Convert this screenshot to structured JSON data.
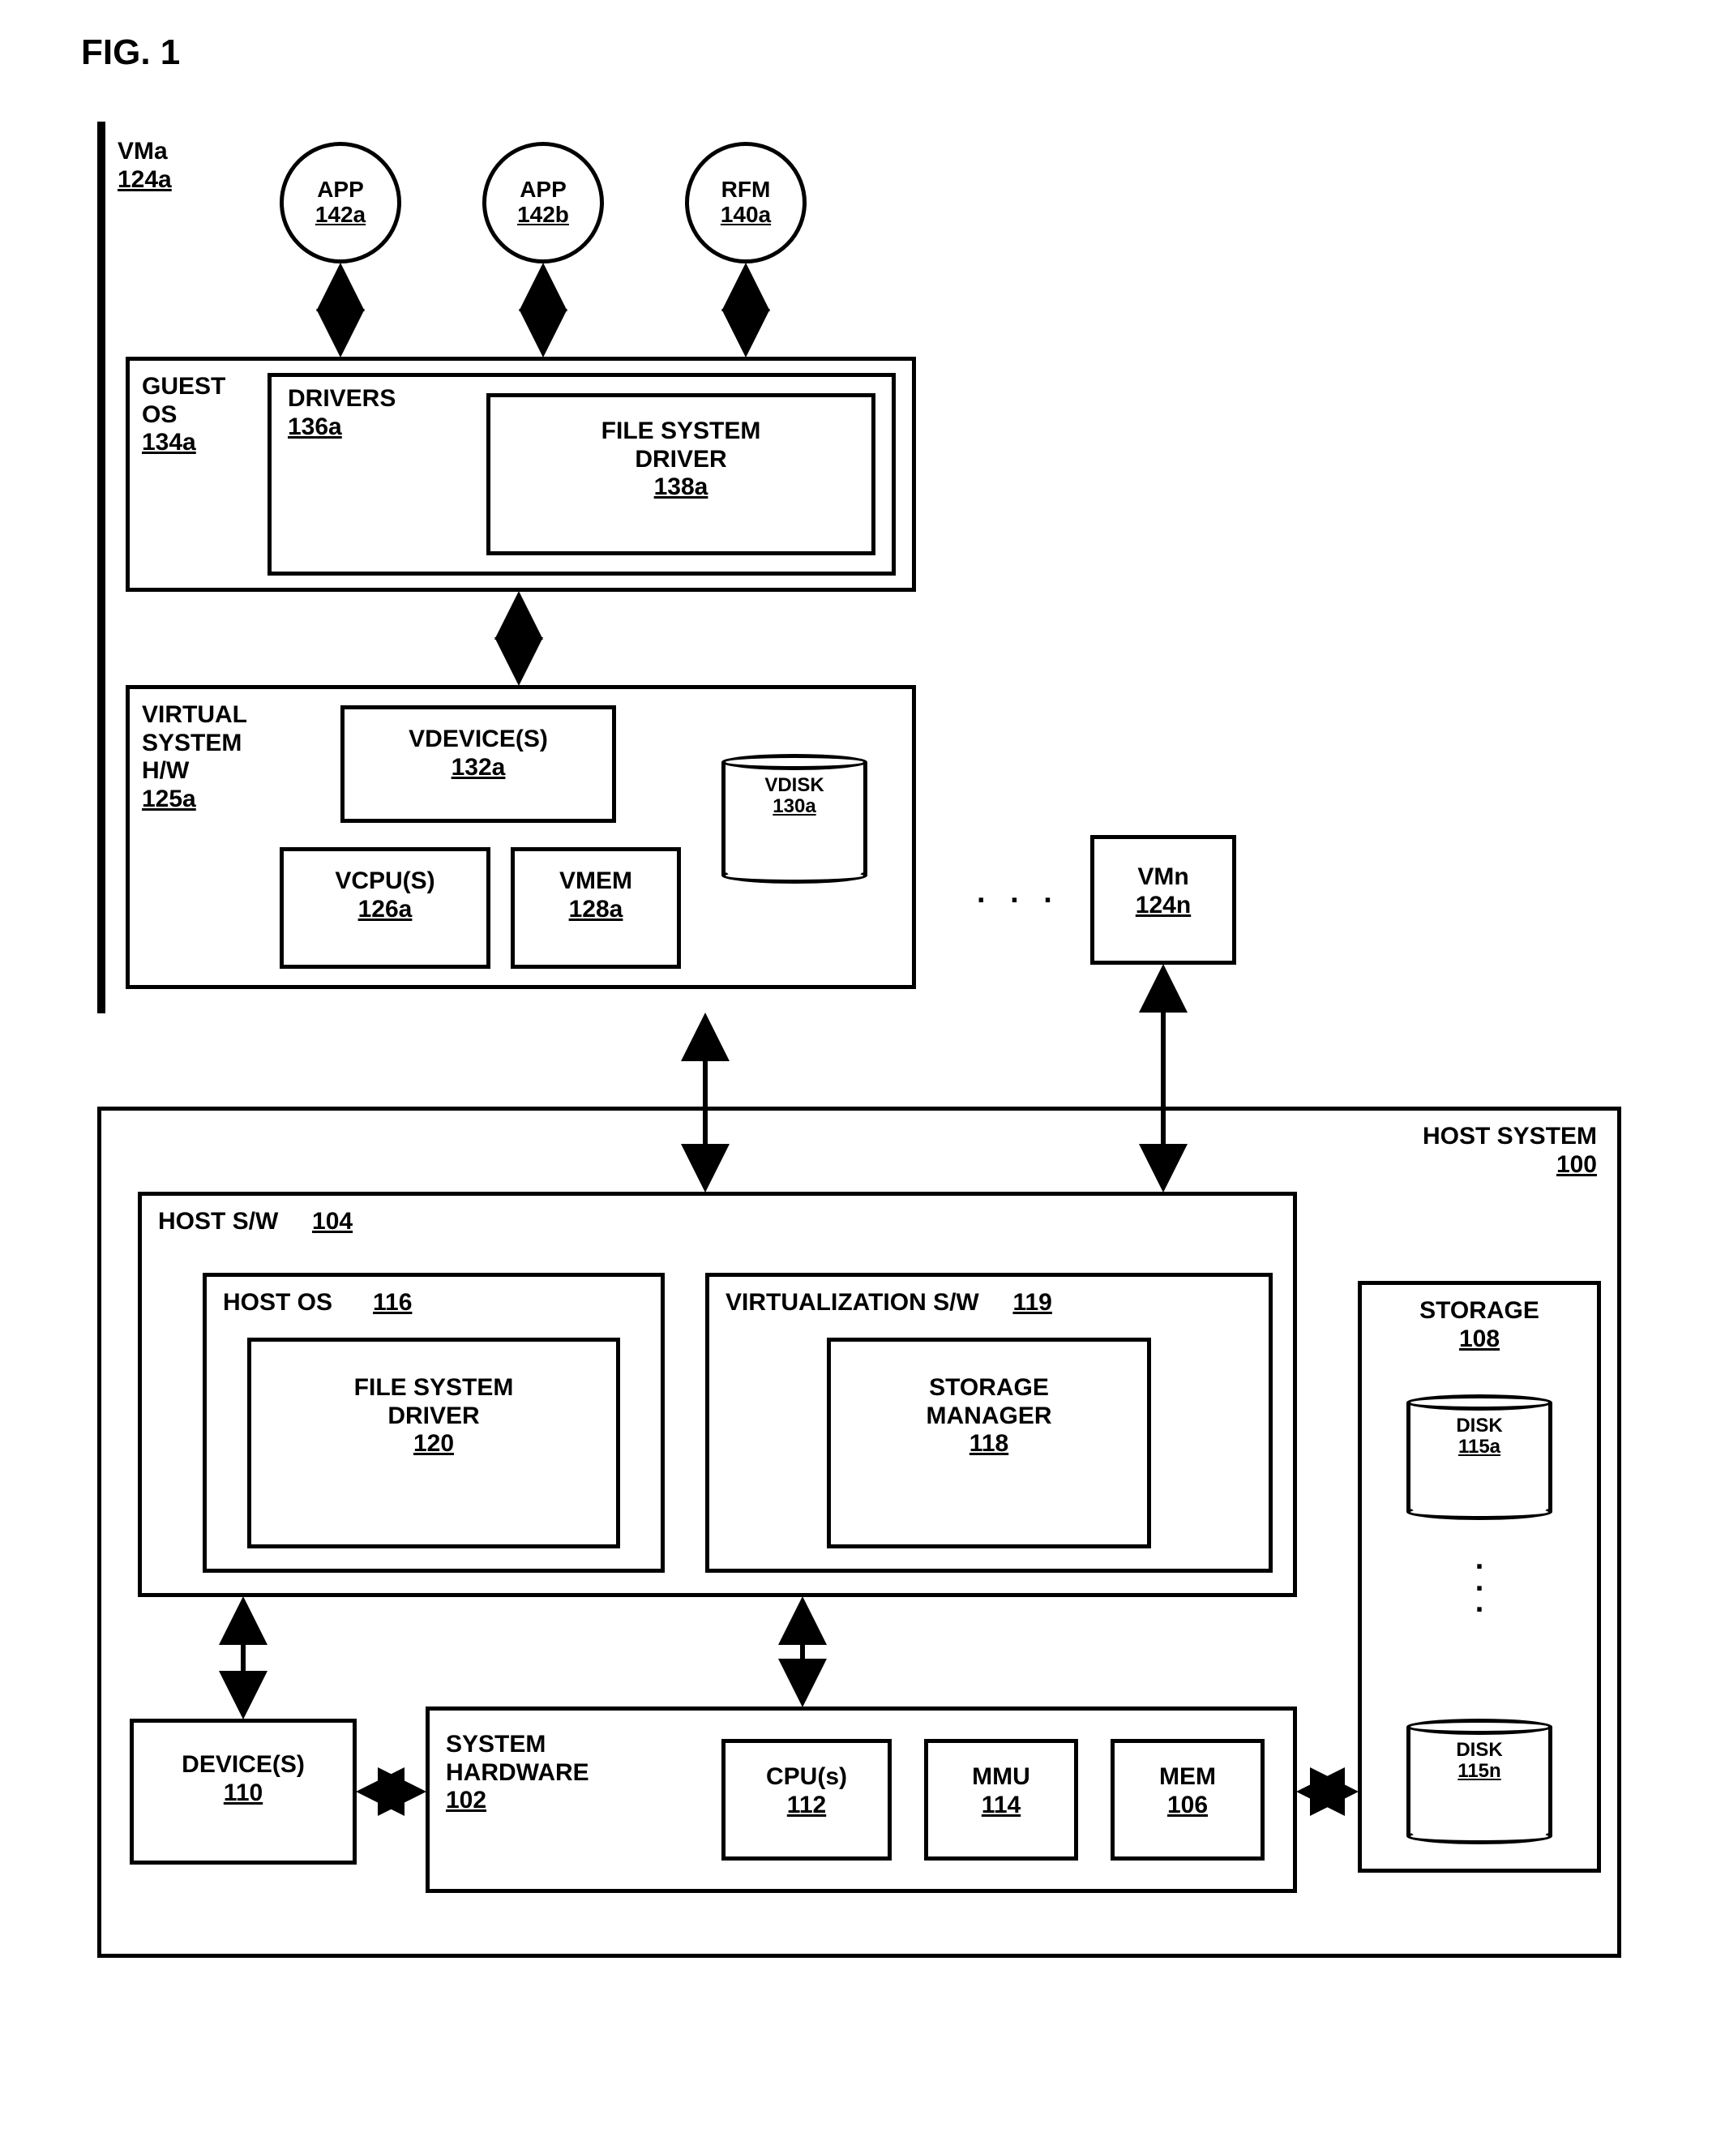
{
  "figure_title": "FIG. 1",
  "vma": {
    "label": "VMa",
    "ref": "124a"
  },
  "app1": {
    "label": "APP",
    "ref": "142a"
  },
  "app2": {
    "label": "APP",
    "ref": "142b"
  },
  "rfm": {
    "label": "RFM",
    "ref": "140a"
  },
  "guestos": {
    "label": "GUEST OS",
    "ref": "134a"
  },
  "drivers": {
    "label": "DRIVERS",
    "ref": "136a"
  },
  "fsdriver_guest": {
    "label": "FILE SYSTEM DRIVER",
    "ref": "138a"
  },
  "vsh": {
    "label": "VIRTUAL SYSTEM H/W",
    "ref": "125a"
  },
  "vdevices": {
    "label": "VDEVICE(S)",
    "ref": "132a"
  },
  "vcpus": {
    "label": "VCPU(S)",
    "ref": "126a"
  },
  "vmem": {
    "label": "VMEM",
    "ref": "128a"
  },
  "vdisk": {
    "label": "VDISK",
    "ref": "130a"
  },
  "vmn": {
    "label": "VMn",
    "ref": "124n"
  },
  "host_system": {
    "label": "HOST SYSTEM",
    "ref": "100"
  },
  "host_sw": {
    "label": "HOST S/W",
    "ref": "104"
  },
  "host_os": {
    "label": "HOST OS",
    "ref": "116"
  },
  "fsdriver_host": {
    "label": "FILE SYSTEM DRIVER",
    "ref": "120"
  },
  "virt_sw": {
    "label": "VIRTUALIZATION S/W",
    "ref": "119"
  },
  "storage_mgr": {
    "label": "STORAGE MANAGER",
    "ref": "118"
  },
  "devices": {
    "label": "DEVICE(S)",
    "ref": "110"
  },
  "sys_hw": {
    "label": "SYSTEM HARDWARE",
    "ref": "102"
  },
  "cpus": {
    "label": "CPU(s)",
    "ref": "112"
  },
  "mmu": {
    "label": "MMU",
    "ref": "114"
  },
  "mem": {
    "label": "MEM",
    "ref": "106"
  },
  "storage": {
    "label": "STORAGE",
    "ref": "108"
  },
  "disk1": {
    "label": "DISK",
    "ref": "115a"
  },
  "diskn": {
    "label": "DISK",
    "ref": "115n"
  }
}
